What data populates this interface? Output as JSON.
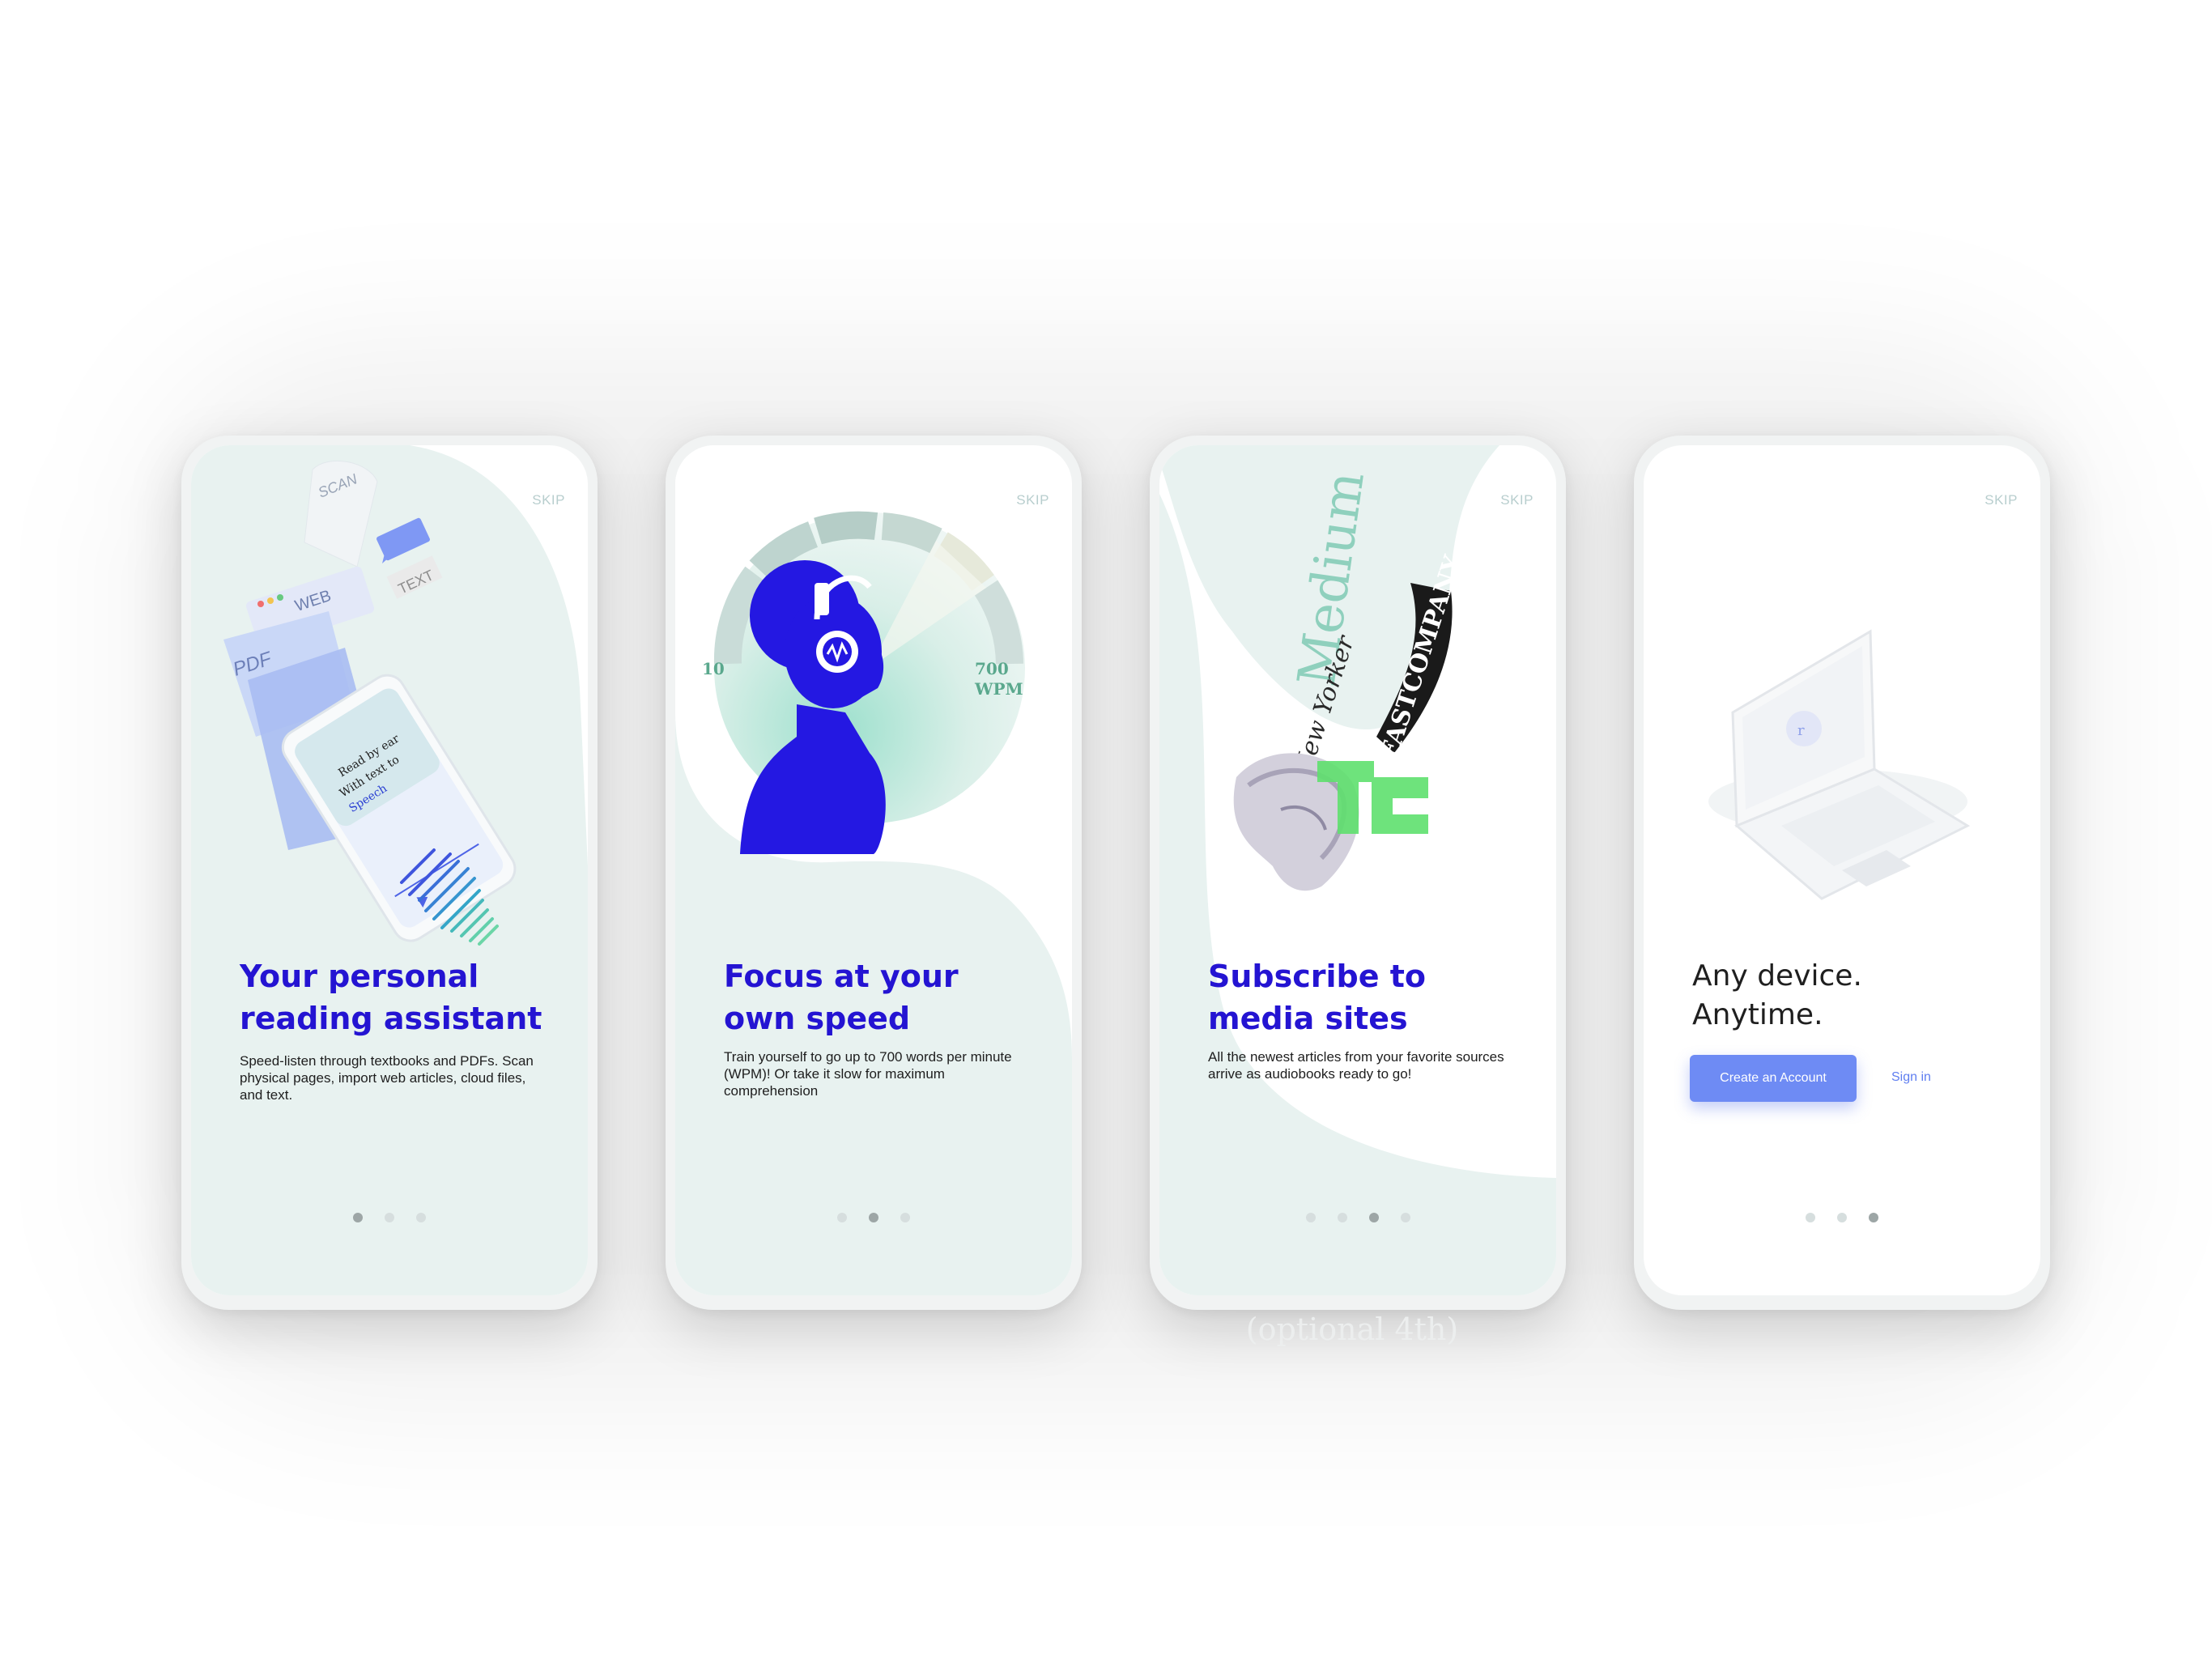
{
  "screens": [
    {
      "skip": "SKIP",
      "title_lines": [
        "Your personal",
        "reading assistant"
      ],
      "body": "Speed-listen through textbooks and PDFs. Scan physical pages, import web articles, cloud files, and text.",
      "illustration_labels": {
        "scan": "SCAN",
        "web": "WEB",
        "text": "TEXT",
        "pdf": "PDF",
        "phone_text": [
          "Read by ear",
          "With text to",
          "Speech"
        ]
      },
      "dots": {
        "count": 3,
        "active": 1
      }
    },
    {
      "skip": "SKIP",
      "title_lines": [
        "Focus at your",
        "own speed"
      ],
      "body": "Train yourself to go up to 700 words per minute (WPM)! Or take it slow for maximum comprehension",
      "gauge": {
        "min_label": "10",
        "max_label": "700",
        "unit": "WPM"
      },
      "dots": {
        "count": 3,
        "active": 2
      }
    },
    {
      "skip": "SKIP",
      "title_lines": [
        "Subscribe to",
        "media sites"
      ],
      "body": "All the newest articles from your favorite sources arrive as audiobooks ready to go!",
      "brands": {
        "medium": "Medium",
        "fast_company": "FASTCOMPANY",
        "new_yorker": "New Yorker"
      },
      "dots": {
        "count": 4,
        "active": 3
      }
    },
    {
      "skip": "SKIP",
      "title_lines": [
        "Any device.",
        "Anytime."
      ],
      "create_button": "Create an Account",
      "sign_in": "Sign in",
      "dots": {
        "count": 3,
        "active": 3
      }
    }
  ],
  "caption": "(optional 4th)",
  "colors": {
    "accent": "#2414d2",
    "mint": "#e8f2f0",
    "button": "#6e8bf4",
    "teal": "#5fbfa8"
  }
}
